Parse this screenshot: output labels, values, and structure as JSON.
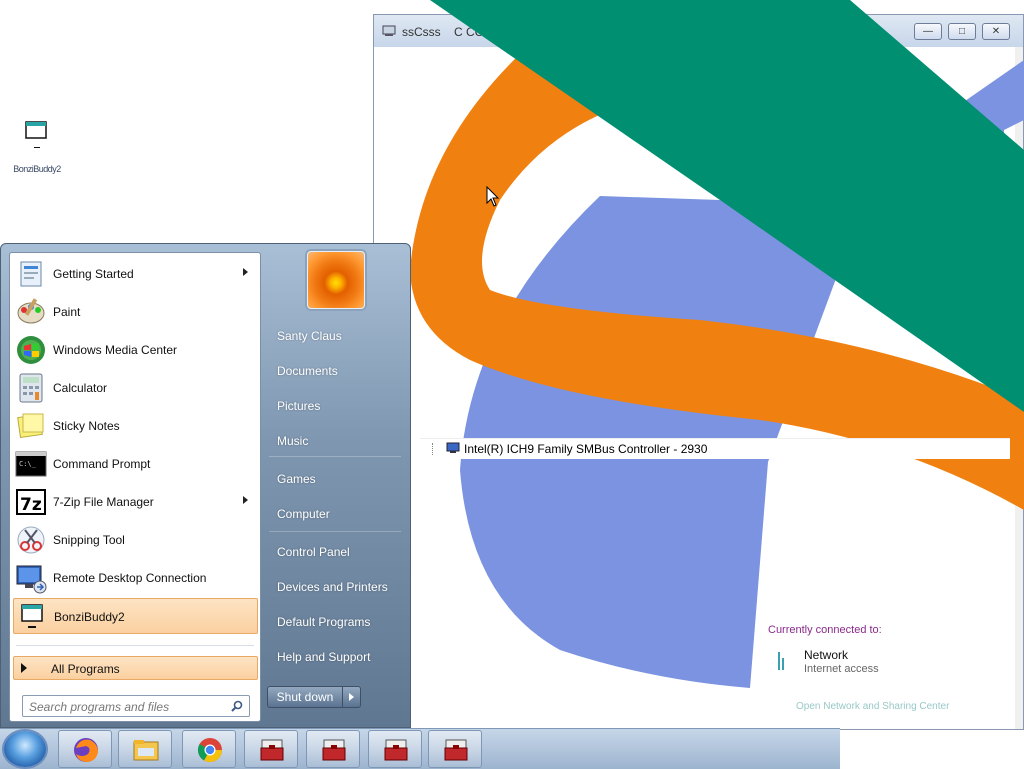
{
  "desktop": {
    "icon_label": "BonziBuddy2"
  },
  "window": {
    "title": "ssCsss    C CCss",
    "minimize_glyph": "—",
    "maximize_glyph": "□",
    "close_glyph": "✕",
    "device_label": "Intel(R) ICH9 Family SMBus Controller - 2930",
    "colors": {
      "orange": "#f08010",
      "blue": "#7b93e0",
      "green": "#008f70"
    }
  },
  "network_flyout": {
    "connected_to": "Currently connected to:",
    "network_name": "Network",
    "network_status": "Internet access",
    "open_link": "Open Network and Sharing Center"
  },
  "start_menu": {
    "programs": [
      {
        "label": "Getting Started",
        "icon": "getting-started-icon",
        "submenu": true
      },
      {
        "label": "Paint",
        "icon": "paint-icon",
        "submenu": false
      },
      {
        "label": "Windows Media Center",
        "icon": "media-center-icon",
        "submenu": false
      },
      {
        "label": "Calculator",
        "icon": "calculator-icon",
        "submenu": false
      },
      {
        "label": "Sticky Notes",
        "icon": "sticky-notes-icon",
        "submenu": false
      },
      {
        "label": "Command Prompt",
        "icon": "command-prompt-icon",
        "submenu": false
      },
      {
        "label": "7-Zip File Manager",
        "icon": "seven-zip-icon",
        "submenu": true
      },
      {
        "label": "Snipping Tool",
        "icon": "snipping-tool-icon",
        "submenu": false
      },
      {
        "label": "Remote Desktop Connection",
        "icon": "remote-desktop-icon",
        "submenu": false
      },
      {
        "label": "BonziBuddy2",
        "icon": "bonzi-icon",
        "submenu": false,
        "highlighted": true
      }
    ],
    "all_programs": "All Programs",
    "search_placeholder": "Search programs and files",
    "right_links": [
      "Santy Claus",
      "Documents",
      "Pictures",
      "Music",
      "Games",
      "Computer",
      "Control Panel",
      "Devices and Printers",
      "Default Programs",
      "Help and Support"
    ],
    "shutdown": "Shut down"
  },
  "taskbar": {
    "items": [
      "start-orb",
      "firefox-icon",
      "explorer-icon",
      "chrome-icon",
      "toolbox-icon",
      "toolbox-icon",
      "toolbox-icon",
      "toolbox-icon"
    ]
  }
}
